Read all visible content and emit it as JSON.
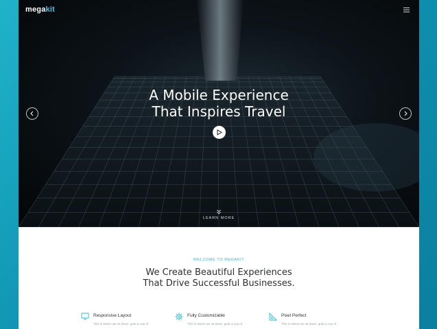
{
  "brand": {
    "name_main": "mega",
    "name_accent": "kit"
  },
  "hero": {
    "title_line1": "A Mobile Experience",
    "title_line2": "That Inspires Travel",
    "learn_more": "LEARN MORE"
  },
  "about": {
    "eyebrow": "WELCOME TO MEGAKIT",
    "title_line1": "We Create Beautiful Experiences",
    "title_line2": "That Drive Successful Businesses."
  },
  "features": [
    {
      "icon": "monitor-icon",
      "title": "Responsive Layout",
      "desc": "This is where we sit down, grab a cup of"
    },
    {
      "icon": "gear-icon",
      "title": "Fully Customizable",
      "desc": "This is where we sit down, grab a cup of"
    },
    {
      "icon": "ruler-triangle-icon",
      "title": "Pixel Perfect",
      "desc": "This is where we sit down, grab a cup of"
    }
  ],
  "colors": {
    "accent": "#2fb8d2",
    "backdrop": "#1299b6",
    "hero_dark": "#0c1318"
  }
}
